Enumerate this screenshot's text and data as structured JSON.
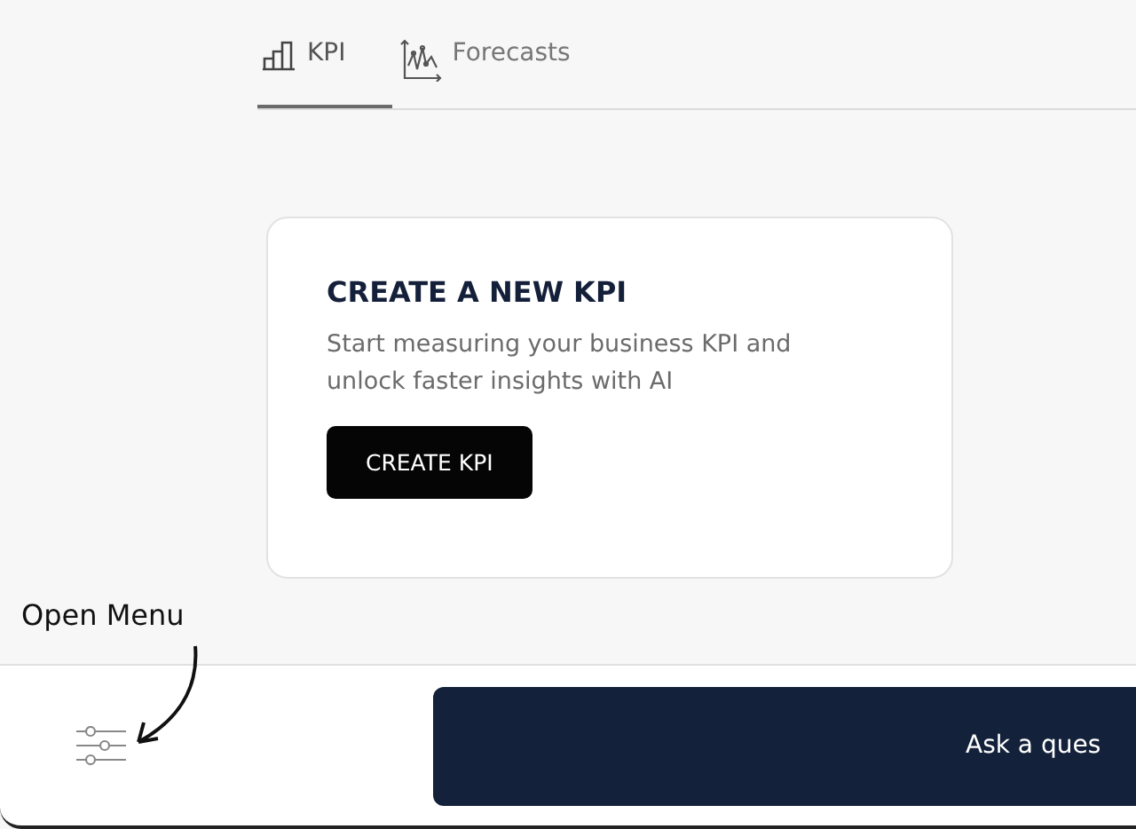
{
  "tabs": [
    {
      "label": "KPI",
      "kind": "bar",
      "selected": true
    },
    {
      "label": "Forecasts",
      "kind": "line",
      "selected": false
    }
  ],
  "card": {
    "title": "CREATE A NEW KPI",
    "text": "Start measuring your business KPI and unlock faster insights with AI",
    "button": "CREATE KPI"
  },
  "annotation": {
    "label": "Open Menu"
  },
  "bottom_bar": {
    "ask_button": "Ask a ques"
  }
}
